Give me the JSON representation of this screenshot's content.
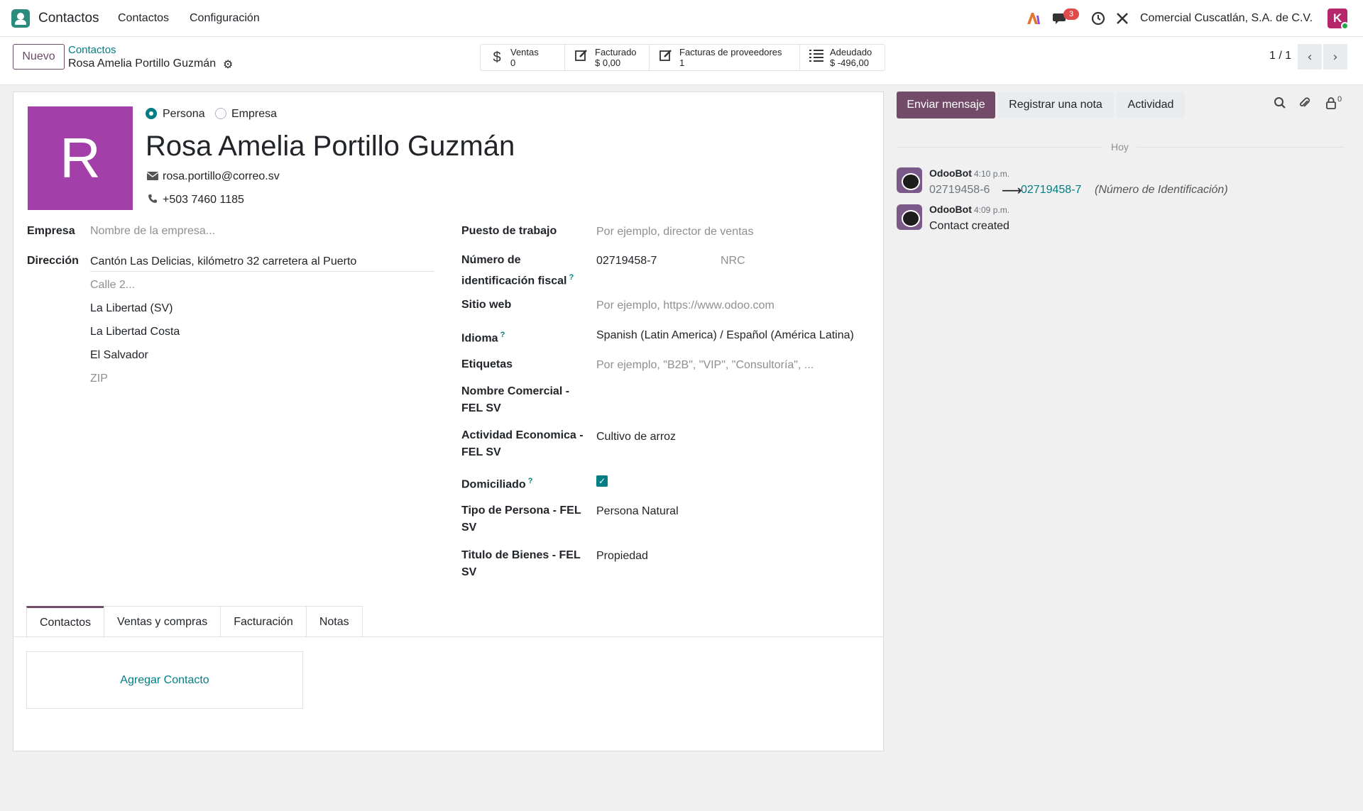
{
  "navbar": {
    "app_name": "Contactos",
    "menu": [
      "Contactos",
      "Configuración"
    ],
    "messages_badge": "3",
    "company": "Comercial Cuscatlán, S.A. de C.V.",
    "user_initial": "K"
  },
  "control": {
    "new_button": "Nuevo",
    "breadcrumb": "Contactos",
    "record_title": "Rosa Amelia Portillo Guzmán",
    "stats": [
      {
        "icon": "dollar-icon",
        "label": "Ventas",
        "value": "0"
      },
      {
        "icon": "pencil-square-icon",
        "label": "Facturado",
        "value": "$ 0,00"
      },
      {
        "icon": "pencil-square-icon",
        "label": "Facturas de proveedores",
        "value": "1"
      },
      {
        "icon": "list-icon",
        "label": "Adeudado",
        "value": "$ -496,00"
      }
    ],
    "pager": "1 / 1"
  },
  "form": {
    "avatar_letter": "R",
    "type_person": "Persona",
    "type_company": "Empresa",
    "name": "Rosa Amelia Portillo Guzmán",
    "email": "rosa.portillo@correo.sv",
    "phone": "+503 7460 1185",
    "company_label": "Empresa",
    "company_placeholder": "Nombre de la empresa...",
    "address_label": "Dirección",
    "street": "Cantón Las Delicias, kilómetro 32 carretera al Puerto",
    "street2_placeholder": "Calle 2...",
    "state": "La Libertad (SV)",
    "city": "La Libertad Costa",
    "country": "El Salvador",
    "zip_placeholder": "ZIP",
    "job_label": "Puesto de trabajo",
    "job_placeholder": "Por ejemplo, director de ventas",
    "vat_label_1": "Número de",
    "vat_label_2": "identificación fiscal",
    "vat_value": "02719458-7",
    "nrc_placeholder": "NRC",
    "website_label": "Sitio web",
    "website_placeholder": "Por ejemplo, https://www.odoo.com",
    "lang_label": "Idioma",
    "lang_value": "Spanish (Latin America) / Español (América Latina)",
    "tags_label": "Etiquetas",
    "tags_placeholder": "Por ejemplo, \"B2B\", \"VIP\", \"Consultoría\", ...",
    "trade_name_label_1": "Nombre Comercial -",
    "trade_name_label_2": "FEL SV",
    "activity_label_1": "Actividad Economica -",
    "activity_label_2": "FEL SV",
    "activity_value": "Cultivo de arroz",
    "domiciled_label": "Domiciliado",
    "domiciled_checked": true,
    "person_type_label_1": "Tipo de Persona - FEL",
    "person_type_label_2": "SV",
    "person_type_value": "Persona Natural",
    "title_label_1": "Titulo de Bienes - FEL",
    "title_label_2": "SV",
    "title_value": "Propiedad",
    "help_mark": "?",
    "tabs": [
      "Contactos",
      "Ventas y compras",
      "Facturación",
      "Notas"
    ],
    "add_contact": "Agregar Contacto"
  },
  "chatter": {
    "send_message": "Enviar mensaje",
    "log_note": "Registrar una nota",
    "activity": "Actividad",
    "followers_count": "0",
    "separator": "Hoy",
    "messages": [
      {
        "author": "OdooBot",
        "time": "4:10 p.m.",
        "old_value": "02719458-6",
        "arrow": "⟶",
        "new_value": "02719458-7",
        "field": "(Número de Identificación)"
      },
      {
        "author": "OdooBot",
        "time": "4:09 p.m.",
        "body": "Contact created"
      }
    ]
  },
  "colors": {
    "primary": "#714b67",
    "link": "#017e84",
    "avatar": "#a33fa8",
    "badge": "#e04a4a"
  }
}
